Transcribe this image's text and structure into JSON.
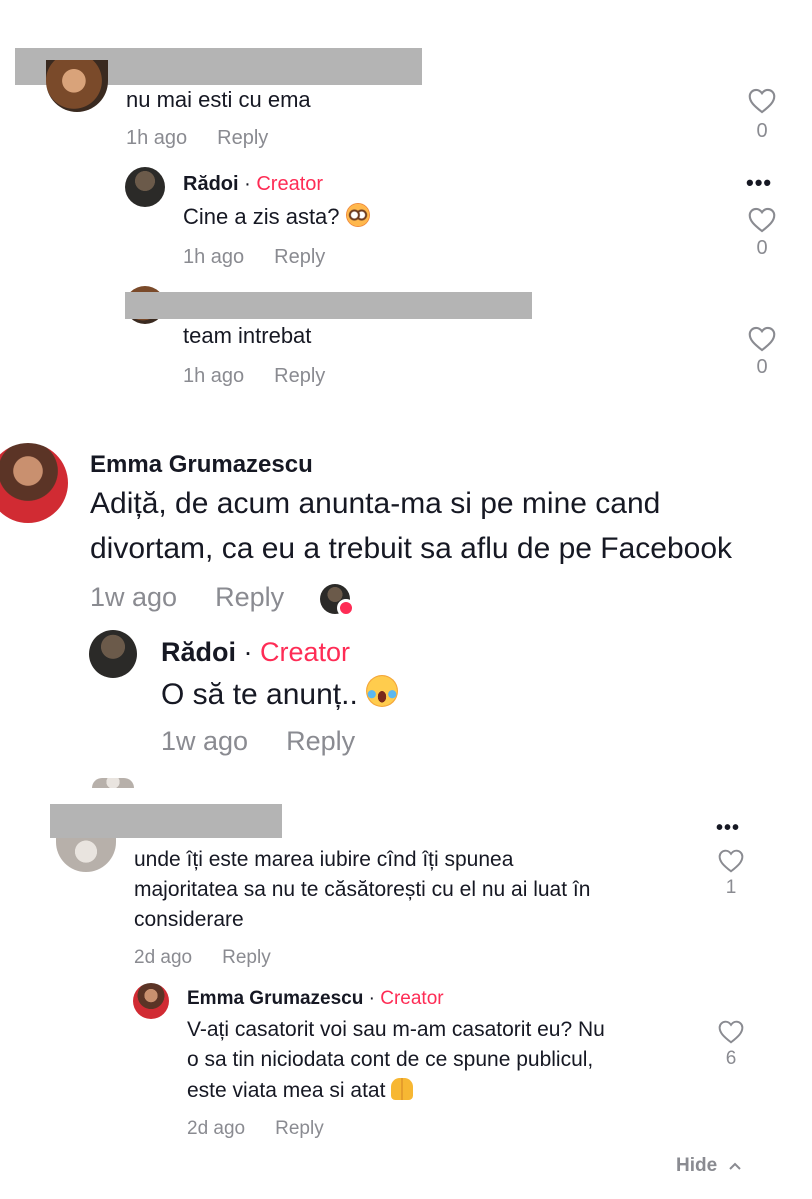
{
  "thread1": {
    "comment": {
      "text": "nu mai esti cu ema",
      "time": "1h ago",
      "reply": "Reply",
      "likes": "0"
    },
    "reply1": {
      "name": "Rădoi",
      "sep": " · ",
      "badge": "Creator",
      "text": "Cine a zis asta?",
      "emoji": "flushed-face",
      "time": "1h ago",
      "reply": "Reply",
      "likes": "0"
    },
    "reply2": {
      "text": "team intrebat",
      "time": "1h ago",
      "reply": "Reply",
      "likes": "0"
    }
  },
  "thread2": {
    "comment": {
      "name": "Emma Grumazescu",
      "line1": "Adiță, de acum anunta-ma si pe mine cand",
      "line2": "divortam, ca eu a trebuit sa aflu de pe Facebook",
      "time": "1w ago",
      "reply": "Reply"
    },
    "reply1": {
      "name": "Rădoi",
      "sep": " · ",
      "badge": "Creator",
      "text": "O să te anunț..",
      "emoji": "tears-of-joy",
      "time": "1w ago",
      "reply": "Reply"
    }
  },
  "thread3": {
    "comment": {
      "line1": "unde îți este marea iubire cînd îți spunea",
      "line2": "majoritatea sa nu te căsătorești cu el nu ai luat în",
      "line3": "considerare",
      "time": "2d ago",
      "reply": "Reply",
      "likes": "1"
    },
    "reply1": {
      "name": "Emma Grumazescu",
      "sep": " · ",
      "badge": "Creator",
      "line1": "V-ați casatorit voi sau m-am casatorit eu? Nu",
      "line2": "o sa tin niciodata cont de ce spune publicul,",
      "line3": "este viata mea si atat",
      "emoji": "folded-hands",
      "time": "2d ago",
      "reply": "Reply",
      "likes": "6"
    },
    "hide_label": "Hide"
  },
  "colors": {
    "creator": "#fe2c55",
    "muted": "#8a8b91",
    "text": "#161823",
    "redaction": "#b4b4b4"
  }
}
